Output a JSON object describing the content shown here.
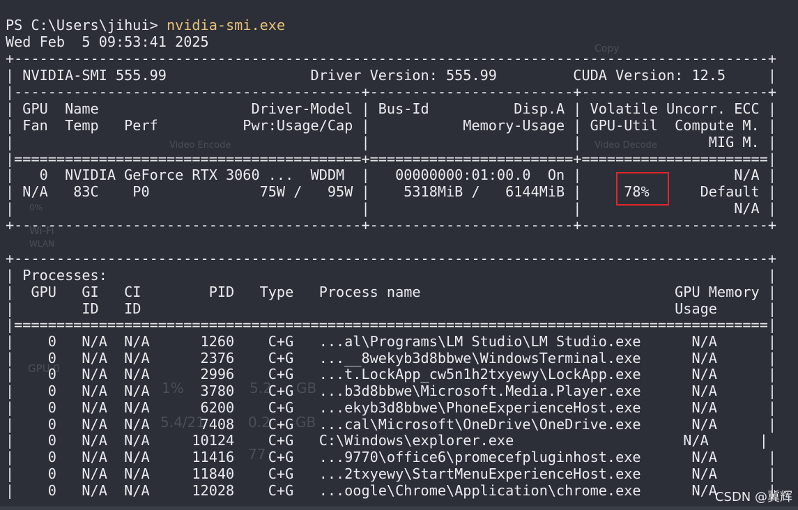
{
  "terminal": {
    "prompt": "PS C:\\Users\\jihui> ",
    "command": "nvidia-smi.exe",
    "timestamp": "Wed Feb  5 09:53:41 2025"
  },
  "smi_header": {
    "version_line": "| NVIDIA-SMI 555.99                 Driver Version: 555.99         CUDA Version: 12.5     |"
  },
  "gpu_table": {
    "header_lines": [
      "| GPU  Name                  Driver-Model | Bus-Id          Disp.A | Volatile Uncorr. ECC |",
      "| Fan  Temp   Perf          Pwr:Usage/Cap |           Memory-Usage | GPU-Util  Compute M. |",
      "|                                         |                        |               MIG M. |"
    ],
    "gpu_rows": [
      "|   0  NVIDIA GeForce RTX 3060 ...  WDDM  |   00000000:01:00.0  On |                  N/A |",
      "| N/A   83C    P0             75W /   95W |    5318MiB /   6144MiB |     78%      Default |",
      "|                                         |                        |                  N/A |"
    ]
  },
  "processes": {
    "title_line": "| Processes:                                                                              |",
    "header_lines": [
      "|  GPU   GI   CI        PID   Type   Process name                              GPU Memory |",
      "|        ID   ID                                                               Usage      |"
    ],
    "rows": [
      "|    0   N/A  N/A      1260    C+G   ...al\\Programs\\LM Studio\\LM Studio.exe      N/A      |",
      "|    0   N/A  N/A      2376    C+G   ...__8wekyb3d8bbwe\\WindowsTerminal.exe      N/A      |",
      "|    0   N/A  N/A      2996    C+G   ...t.LockApp_cw5n1h2txyewy\\LockApp.exe      N/A      |",
      "|    0   N/A  N/A      3780    C+G   ...b3d8bbwe\\Microsoft.Media.Player.exe      N/A      |",
      "|    0   N/A  N/A      6200    C+G   ...ekyb3d8bbwe\\PhoneExperienceHost.exe      N/A      |",
      "|    0   N/A  N/A      7408    C+G   ...cal\\Microsoft\\OneDrive\\OneDrive.exe      N/A      |",
      "|    0   N/A  N/A     10124    C+G   C:\\Windows\\explorer.exe                    N/A      |",
      "|    0   N/A  N/A     11416    C+G   ...9770\\office6\\promecefpluginhost.exe      N/A      |",
      "|    0   N/A  N/A     11840    C+G   ...2txyewy\\StartMenuExperienceHost.exe      N/A      |",
      "|    0   N/A  N/A     12028    C+G   ...oogle\\Chrome\\Application\\chrome.exe      N/A      |"
    ]
  },
  "borders": {
    "outer": "+-----------------------------------------------------------------------------------------+",
    "inner": "|-----------------------------------------+------------------------+----------------------+",
    "double": "|=========================================+========================+======================|",
    "table_bottom": "+-----------------------------------------+------------------------+----------------------+",
    "proc_double": "|=========================================================================================|"
  },
  "ghost_layer": {
    "items": [
      "Copy",
      "Video Encode",
      "Video Decode",
      "0%",
      "Wi-Fi",
      "WLAN",
      "GPU 0",
      "1%",
      "5.2",
      "GB",
      "5.4/21",
      "0.2",
      "GB",
      "77"
    ]
  },
  "watermark": "CSDN @冀辉",
  "highlight": {
    "target": "GPU-Util 78%",
    "color": "#e0262a"
  }
}
